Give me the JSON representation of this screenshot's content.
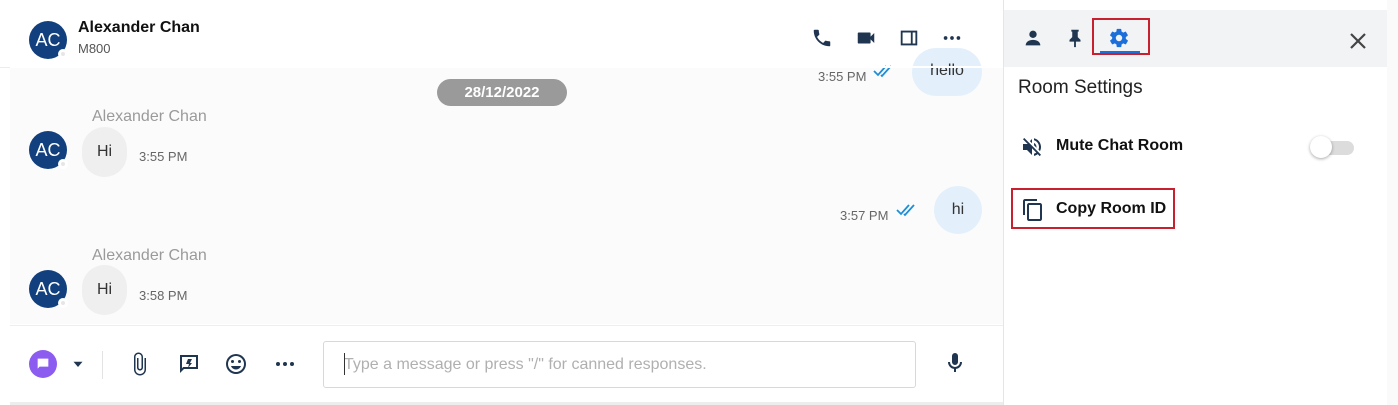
{
  "header": {
    "avatar_initials": "AC",
    "name": "Alexander Chan",
    "subtitle": "M800",
    "icons": [
      "phone-icon",
      "video-icon",
      "split-view-icon",
      "more-icon"
    ]
  },
  "messages": {
    "date_separator": "28/12/2022",
    "items": [
      {
        "direction": "outgoing",
        "text": "hello",
        "time": "3:55 PM",
        "status": "read"
      },
      {
        "direction": "incoming",
        "sender": "Alexander Chan",
        "initials": "AC",
        "text": "Hi",
        "time": "3:55 PM"
      },
      {
        "direction": "outgoing",
        "text": "hi",
        "time": "3:57 PM",
        "status": "read"
      },
      {
        "direction": "incoming",
        "sender": "Alexander Chan",
        "initials": "AC",
        "text": "Hi",
        "time": "3:58 PM"
      }
    ]
  },
  "composer": {
    "placeholder": "Type a message or press \"/\" for canned responses.",
    "value": "",
    "icons": [
      "chat-type-icon",
      "dropdown-arrow-icon",
      "attachment-icon",
      "canned-response-icon",
      "emoji-icon",
      "more-icon",
      "microphone-icon"
    ]
  },
  "panel": {
    "tabs": [
      "profile-icon",
      "pin-icon",
      "gear-icon"
    ],
    "active_tab": "gear-icon",
    "title": "Room Settings",
    "mute_label": "Mute Chat Room",
    "mute_enabled": false,
    "copy_label": "Copy Room ID"
  },
  "colors": {
    "avatar": "#123f7d",
    "accent_blue": "#1c6fd8",
    "highlight_red": "#c8202f",
    "outgoing_bubble": "#e3f0fb",
    "incoming_bubble": "#efefef",
    "date_chip": "#9a9a9a"
  }
}
